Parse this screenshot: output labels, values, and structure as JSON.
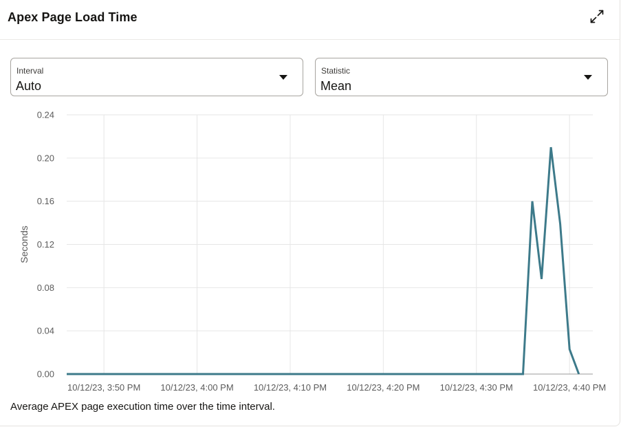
{
  "card": {
    "title": "Apex Page Load Time",
    "caption": "Average APEX page execution time over the time interval."
  },
  "interval": {
    "label": "Interval",
    "value": "Auto"
  },
  "statistic": {
    "label": "Statistic",
    "value": "Mean"
  },
  "icons": {
    "expand": "expand-icon",
    "dropdown": "chevron-down-icon"
  },
  "colors": {
    "series": "#3d7a8a",
    "grid": "#e6e6e6",
    "axis_text": "#5b5b5b"
  },
  "chart_data": {
    "type": "line",
    "title": "",
    "ylabel": "Seconds",
    "xlabel": "",
    "ylim": [
      0,
      0.24
    ],
    "yticks": [
      "0.00",
      "0.04",
      "0.08",
      "0.12",
      "0.16",
      "0.20",
      "0.24"
    ],
    "xtick_labels": [
      "10/12/23, 3:50 PM",
      "10/12/23, 4:00 PM",
      "10/12/23, 4:10 PM",
      "10/12/23, 4:20 PM",
      "10/12/23, 4:30 PM",
      "10/12/23, 4:40 PM"
    ],
    "xlim_minutes_after_350": [
      -4,
      52.5
    ],
    "grid": true,
    "series": [
      {
        "points": [
          {
            "x": "3:46 PM",
            "y": 0
          },
          {
            "x": "3:50 PM",
            "y": 0
          },
          {
            "x": "4:00 PM",
            "y": 0
          },
          {
            "x": "4:10 PM",
            "y": 0
          },
          {
            "x": "4:20 PM",
            "y": 0
          },
          {
            "x": "4:30 PM",
            "y": 0
          },
          {
            "x": "4:35 PM",
            "y": 0
          },
          {
            "x": "4:36 PM",
            "y": 0.16
          },
          {
            "x": "4:37 PM",
            "y": 0.088
          },
          {
            "x": "4:38 PM",
            "y": 0.21
          },
          {
            "x": "4:39 PM",
            "y": 0.139
          },
          {
            "x": "4:40 PM",
            "y": 0.023
          },
          {
            "x": "4:41 PM",
            "y": 0
          }
        ]
      }
    ]
  }
}
